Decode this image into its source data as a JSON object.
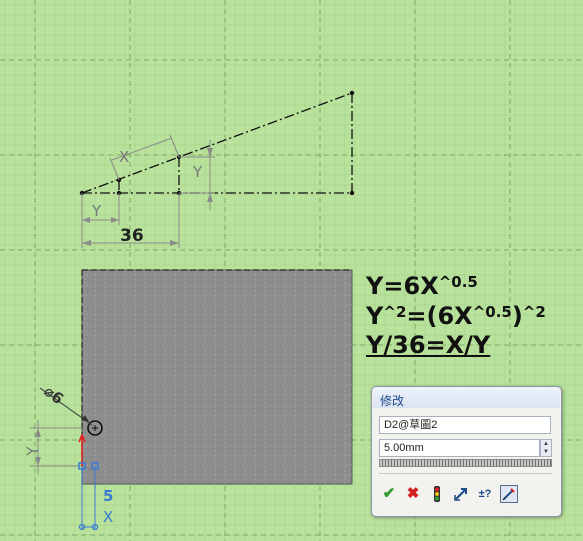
{
  "sketch": {
    "dim_36": "36",
    "dim_x": "X",
    "dim_y_left": "Y",
    "dim_y_right": "Y",
    "dim_diameter": "⌀6",
    "dim_y_bottom": "Y",
    "dim_5": "5",
    "dim_x_bottom": "X"
  },
  "equations": {
    "line1_base": "Y=6X",
    "line1_exp": "^0.5",
    "line2_a": "Y",
    "line2_a_exp": "^2",
    "line2_b": "=(6X",
    "line2_b_exp": "^0.5",
    "line2_c": ")",
    "line2_c_exp": "^2",
    "line3": "Y/36=X/Y"
  },
  "dialog": {
    "title": "修改",
    "dimension_name": "D2@草圖2",
    "value": "5.00mm",
    "buttons": {
      "ok": "✔",
      "cancel": "✖",
      "rebuild": "rebuild-icon",
      "reverse": "reverse-sense-icon",
      "mark": "±?",
      "mark_driven": "mark-dimension-icon"
    }
  },
  "colors": {
    "background": "#b9e29c",
    "grid": "#8fbf78",
    "rect_fill": "#8c8c8c",
    "geometry": "#111111",
    "dimension": "#8a8a8a",
    "selected": "#3a7bd5",
    "constraint_red": "#e02020"
  }
}
